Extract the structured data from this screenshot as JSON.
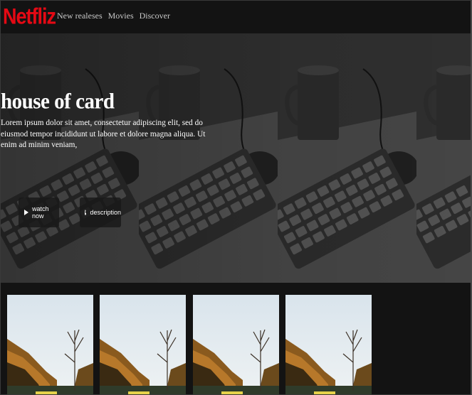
{
  "navbar": {
    "logo": "Netfliz",
    "links": [
      "New realeses",
      "Movies",
      "Discover"
    ]
  },
  "hero": {
    "title": "house of card",
    "description": "Lorem ipsum dolor sit amet, consectetur adipiscing elit, sed do eiusmod tempor incididunt ut labore et dolore magna aliqua. Ut enim ad minim veniam,",
    "watch_label": "watch now",
    "description_label": "description",
    "watch_icon": "play-icon",
    "description_icon": "info-icon"
  },
  "row": {
    "posters": [
      "poster-1",
      "poster-2",
      "poster-3",
      "poster-4"
    ]
  },
  "colors": {
    "logo": "#e50914",
    "background": "#141414",
    "navbar": "#131313"
  }
}
